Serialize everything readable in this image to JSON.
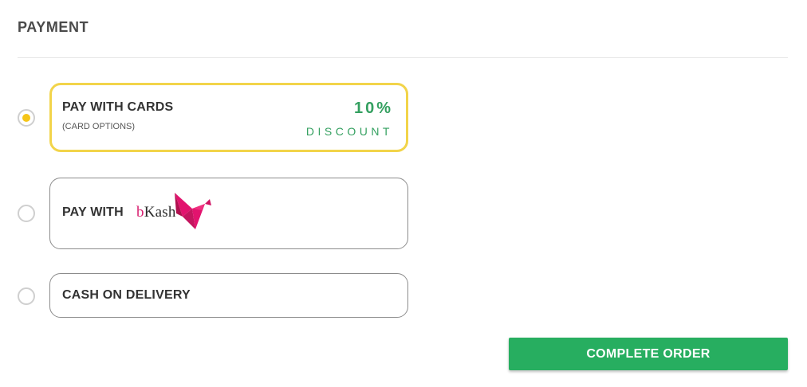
{
  "section": {
    "title": "PAYMENT"
  },
  "options": [
    {
      "id": "cards",
      "selected": true,
      "title": "PAY WITH CARDS",
      "subtitle": "(CARD OPTIONS)",
      "discount_percent": "10%",
      "discount_label": "DISCOUNT"
    },
    {
      "id": "bkash",
      "selected": false,
      "title": "PAY WITH",
      "logo_text_b": "b",
      "logo_text_rest": "Kash",
      "logo_icon": "bkash-bird-icon"
    },
    {
      "id": "cod",
      "selected": false,
      "title": "CASH ON DELIVERY"
    }
  ],
  "actions": {
    "complete_label": "COMPLETE ORDER"
  },
  "colors": {
    "accent_green": "#27ae60",
    "discount_green": "#34a060",
    "selected_border": "#f2d44a",
    "radio_dot": "#f5c518",
    "bkash_pink": "#d81c6e"
  }
}
